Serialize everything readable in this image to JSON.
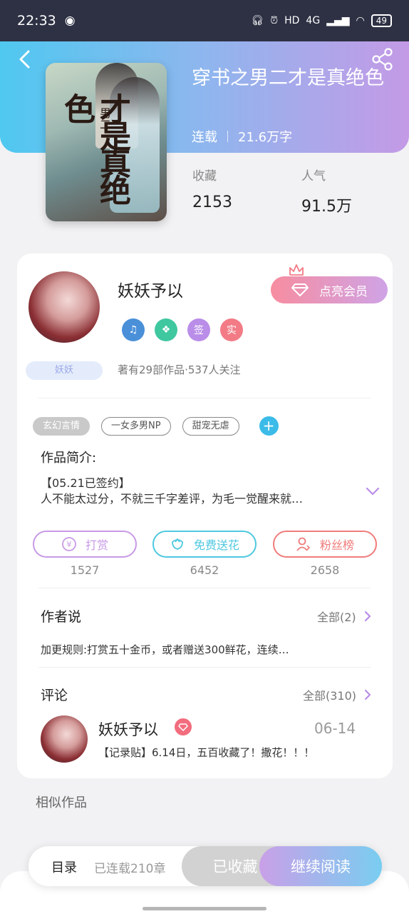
{
  "status_bar": {
    "time": "22:33",
    "network": "4G",
    "battery": "49"
  },
  "book": {
    "title": "穿书之男二才是真绝色",
    "status": "连载",
    "word_count": "21.6万字",
    "cover_title": "才是真绝色",
    "cover_subtitle": "男二",
    "stats": [
      {
        "label": "收藏",
        "value": "2153"
      },
      {
        "label": "人气",
        "value": "91.5万"
      }
    ]
  },
  "author": {
    "name": "妖妖予以",
    "tag": "妖妖",
    "stats": "著有29部作品·537人关注",
    "vip_button": "点亮会员",
    "badges": [
      {
        "icon": "music-badge-icon",
        "text": "",
        "color": "#4a90d9"
      },
      {
        "icon": "handshake-badge-icon",
        "text": "",
        "color": "#3fc7a0"
      },
      {
        "icon": "sign-badge-icon",
        "text": "签",
        "color": "#b98de8"
      },
      {
        "icon": "real-badge-icon",
        "text": "实",
        "color": "#f27b86"
      }
    ]
  },
  "tags": [
    "玄幻言情",
    "一女多男NP",
    "甜宠无虐"
  ],
  "intro": {
    "label": "作品简介:",
    "line1": "【05.21已签约】",
    "line2": "人不能太过分，不就三千字差评，为毛一觉醒来就…"
  },
  "actions": [
    {
      "label": "打赏",
      "count": "1527",
      "color": "#c89ae6",
      "icon": "coin-icon"
    },
    {
      "label": "免费送花",
      "count": "6452",
      "color": "#4fc8e0",
      "icon": "flower-icon"
    },
    {
      "label": "粉丝榜",
      "count": "2658",
      "color": "#f07c7c",
      "icon": "fans-icon"
    }
  ],
  "author_says": {
    "title": "作者说",
    "link": "全部(2)",
    "text": "加更规则:打赏五十金币，或者赠送300鲜花，连续…"
  },
  "comments": {
    "title": "评论",
    "link": "全部(310)",
    "items": [
      {
        "name": "妖妖予以",
        "date": "06-14",
        "text": "【记录贴】6.14日，五百收藏了！撒花！！！"
      }
    ]
  },
  "similar_title": "相似作品",
  "bottom_bar": {
    "toc": "目录",
    "chapters": "已连载210章",
    "collected": "已收藏",
    "read": "继续阅读"
  }
}
